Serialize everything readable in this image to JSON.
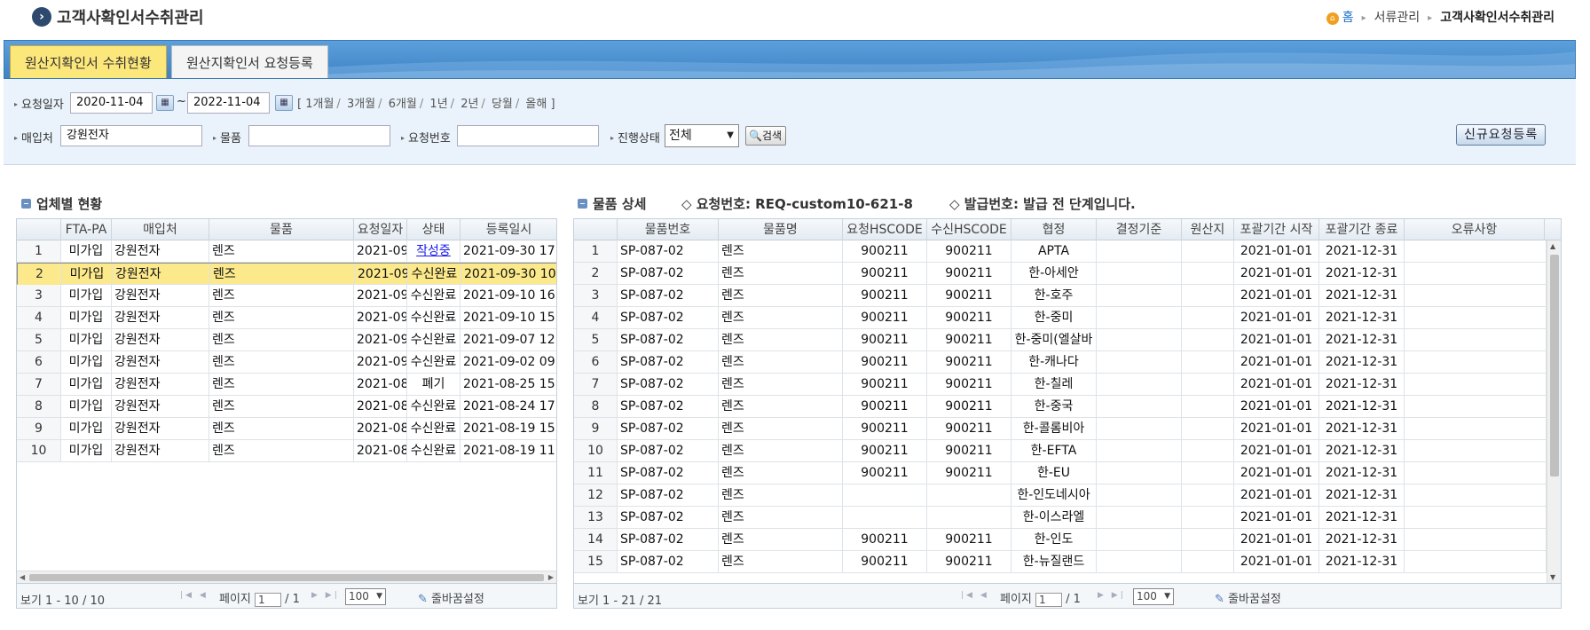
{
  "page": {
    "title": "고객사확인서수취관리",
    "breadcrumb": {
      "home": "홈",
      "level1": "서류관리",
      "current": "고객사확인서수취관리"
    }
  },
  "tabs": [
    {
      "label": "원산지확인서 수취현황",
      "active": true
    },
    {
      "label": "원산지확인서 요청등록",
      "active": false
    }
  ],
  "search": {
    "request_date_label": "요청일자",
    "date_from": "2020-11-04",
    "tilde": "~",
    "date_to": "2022-11-04",
    "period_open": "[",
    "periods": [
      "1개월",
      "3개월",
      "6개월",
      "1년",
      "2년",
      "당월",
      "올해"
    ],
    "period_close": "]",
    "buyer_label": "매입처",
    "buyer_value": "강원전자",
    "item_label": "물품",
    "item_value": "",
    "request_no_label": "요청번호",
    "request_no_value": "",
    "status_label": "진행상태",
    "status_value": "전체",
    "search_button": "검색",
    "new_request_button": "신규요청등록"
  },
  "left_section": {
    "title": "업체별 현황",
    "columns": [
      "FTA-PA",
      "매입처",
      "물품",
      "요청일자",
      "상태",
      "등록일시"
    ],
    "rows": [
      {
        "no": "1",
        "fta": "미가입",
        "buyer": "강원전자",
        "item": "렌즈",
        "req_date": "2021-09",
        "status": "작성중",
        "status_link": true,
        "reg": "2021-09-30 17"
      },
      {
        "no": "2",
        "fta": "미가입",
        "buyer": "강원전자",
        "item": "렌즈",
        "req_date": "2021-09",
        "status": "수신완료",
        "status_link": false,
        "reg": "2021-09-30 10"
      },
      {
        "no": "3",
        "fta": "미가입",
        "buyer": "강원전자",
        "item": "렌즈",
        "req_date": "2021-09",
        "status": "수신완료",
        "status_link": false,
        "reg": "2021-09-10 16"
      },
      {
        "no": "4",
        "fta": "미가입",
        "buyer": "강원전자",
        "item": "렌즈",
        "req_date": "2021-09",
        "status": "수신완료",
        "status_link": false,
        "reg": "2021-09-10 15"
      },
      {
        "no": "5",
        "fta": "미가입",
        "buyer": "강원전자",
        "item": "렌즈",
        "req_date": "2021-09",
        "status": "수신완료",
        "status_link": false,
        "reg": "2021-09-07 12"
      },
      {
        "no": "6",
        "fta": "미가입",
        "buyer": "강원전자",
        "item": "렌즈",
        "req_date": "2021-09",
        "status": "수신완료",
        "status_link": false,
        "reg": "2021-09-02 09"
      },
      {
        "no": "7",
        "fta": "미가입",
        "buyer": "강원전자",
        "item": "렌즈",
        "req_date": "2021-08",
        "status": "폐기",
        "status_link": false,
        "reg": "2021-08-25 15"
      },
      {
        "no": "8",
        "fta": "미가입",
        "buyer": "강원전자",
        "item": "렌즈",
        "req_date": "2021-08",
        "status": "수신완료",
        "status_link": false,
        "reg": "2021-08-24 17"
      },
      {
        "no": "9",
        "fta": "미가입",
        "buyer": "강원전자",
        "item": "렌즈",
        "req_date": "2021-08",
        "status": "수신완료",
        "status_link": false,
        "reg": "2021-08-19 15"
      },
      {
        "no": "10",
        "fta": "미가입",
        "buyer": "강원전자",
        "item": "렌즈",
        "req_date": "2021-08",
        "status": "수신완료",
        "status_link": false,
        "reg": "2021-08-19 11"
      }
    ],
    "selected_row": 1,
    "pager": {
      "view": "보기 1 - 10 / 10",
      "page_label": "페이지",
      "page": "1",
      "of": "/ 1",
      "page_size": "100",
      "wrap_label": "줄바꿈설정"
    }
  },
  "right_section": {
    "title": "물품 상세",
    "request_no": "◇ 요청번호: REQ-custom10-621-8",
    "issue_no": "◇ 발급번호: 발급 전 단계입니다.",
    "columns": [
      "물품번호",
      "물품명",
      "요청HSCODE",
      "수신HSCODE",
      "협정",
      "결정기준",
      "원산지",
      "포괄기간 시작",
      "포괄기간 종료",
      "오류사항"
    ],
    "rows": [
      {
        "no": "1",
        "code": "SP-087-02",
        "name": "렌즈",
        "req_hs": "900211",
        "rcv_hs": "900211",
        "agreement": "APTA",
        "start": "2021-01-01",
        "end": "2021-12-31"
      },
      {
        "no": "2",
        "code": "SP-087-02",
        "name": "렌즈",
        "req_hs": "900211",
        "rcv_hs": "900211",
        "agreement": "한-아세안",
        "start": "2021-01-01",
        "end": "2021-12-31"
      },
      {
        "no": "3",
        "code": "SP-087-02",
        "name": "렌즈",
        "req_hs": "900211",
        "rcv_hs": "900211",
        "agreement": "한-호주",
        "start": "2021-01-01",
        "end": "2021-12-31"
      },
      {
        "no": "4",
        "code": "SP-087-02",
        "name": "렌즈",
        "req_hs": "900211",
        "rcv_hs": "900211",
        "agreement": "한-중미",
        "start": "2021-01-01",
        "end": "2021-12-31"
      },
      {
        "no": "5",
        "code": "SP-087-02",
        "name": "렌즈",
        "req_hs": "900211",
        "rcv_hs": "900211",
        "agreement": "한-중미(엘살바",
        "start": "2021-01-01",
        "end": "2021-12-31"
      },
      {
        "no": "6",
        "code": "SP-087-02",
        "name": "렌즈",
        "req_hs": "900211",
        "rcv_hs": "900211",
        "agreement": "한-캐나다",
        "start": "2021-01-01",
        "end": "2021-12-31"
      },
      {
        "no": "7",
        "code": "SP-087-02",
        "name": "렌즈",
        "req_hs": "900211",
        "rcv_hs": "900211",
        "agreement": "한-칠레",
        "start": "2021-01-01",
        "end": "2021-12-31"
      },
      {
        "no": "8",
        "code": "SP-087-02",
        "name": "렌즈",
        "req_hs": "900211",
        "rcv_hs": "900211",
        "agreement": "한-중국",
        "start": "2021-01-01",
        "end": "2021-12-31"
      },
      {
        "no": "9",
        "code": "SP-087-02",
        "name": "렌즈",
        "req_hs": "900211",
        "rcv_hs": "900211",
        "agreement": "한-콜롬비아",
        "start": "2021-01-01",
        "end": "2021-12-31"
      },
      {
        "no": "10",
        "code": "SP-087-02",
        "name": "렌즈",
        "req_hs": "900211",
        "rcv_hs": "900211",
        "agreement": "한-EFTA",
        "start": "2021-01-01",
        "end": "2021-12-31"
      },
      {
        "no": "11",
        "code": "SP-087-02",
        "name": "렌즈",
        "req_hs": "900211",
        "rcv_hs": "900211",
        "agreement": "한-EU",
        "start": "2021-01-01",
        "end": "2021-12-31"
      },
      {
        "no": "12",
        "code": "SP-087-02",
        "name": "렌즈",
        "req_hs": "",
        "rcv_hs": "",
        "agreement": "한-인도네시아",
        "start": "2021-01-01",
        "end": "2021-12-31"
      },
      {
        "no": "13",
        "code": "SP-087-02",
        "name": "렌즈",
        "req_hs": "",
        "rcv_hs": "",
        "agreement": "한-이스라엘",
        "start": "2021-01-01",
        "end": "2021-12-31"
      },
      {
        "no": "14",
        "code": "SP-087-02",
        "name": "렌즈",
        "req_hs": "900211",
        "rcv_hs": "900211",
        "agreement": "한-인도",
        "start": "2021-01-01",
        "end": "2021-12-31"
      },
      {
        "no": "15",
        "code": "SP-087-02",
        "name": "렌즈",
        "req_hs": "900211",
        "rcv_hs": "900211",
        "agreement": "한-뉴질랜드",
        "start": "2021-01-01",
        "end": "2021-12-31"
      }
    ],
    "pager": {
      "view": "보기 1 - 21 / 21",
      "page_label": "페이지",
      "page": "1",
      "of": "/ 1",
      "page_size": "100",
      "wrap_label": "줄바꿈설정"
    }
  },
  "colors": {
    "tab_active": "#fce77a",
    "tab_bar": "#4a8fd0",
    "selected_row": "#fbe98c",
    "link": "#1a1aee"
  },
  "icons": {
    "title": "chevron-right-circle-icon",
    "home": "home-icon",
    "calendar": "calendar-icon",
    "search": "magnifier-icon",
    "wrap": "pencil-icon"
  }
}
